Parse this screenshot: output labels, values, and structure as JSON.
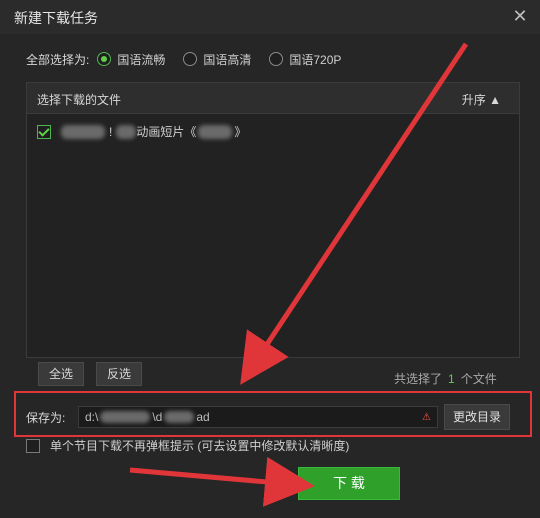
{
  "window": {
    "title": "新建下载任务"
  },
  "quality": {
    "label": "全部选择为:",
    "options": [
      {
        "label": "国语流畅",
        "checked": true
      },
      {
        "label": "国语高清",
        "checked": false
      },
      {
        "label": "国语720P",
        "checked": false
      }
    ]
  },
  "files": {
    "header": "选择下载的文件",
    "sort": "升序",
    "items": [
      {
        "name": "动画短片《",
        "name_end": "》",
        "checked": true
      }
    ]
  },
  "buttons": {
    "select_all": "全选",
    "invert": "反选",
    "change_dir": "更改目录",
    "download": "下 载"
  },
  "selection_count": {
    "prefix": "共选择了",
    "value": "1",
    "suffix": "个文件"
  },
  "save": {
    "label": "保存为:",
    "path_start": "d:\\",
    "path_mid": "\\d",
    "path_end": "ad"
  },
  "no_popup": {
    "label": "单个节目下载不再弹框提示 (可去设置中修改默认清晰度)",
    "checked": false
  },
  "colors": {
    "accent": "#2fa12b",
    "annotation": "#e0363a"
  }
}
